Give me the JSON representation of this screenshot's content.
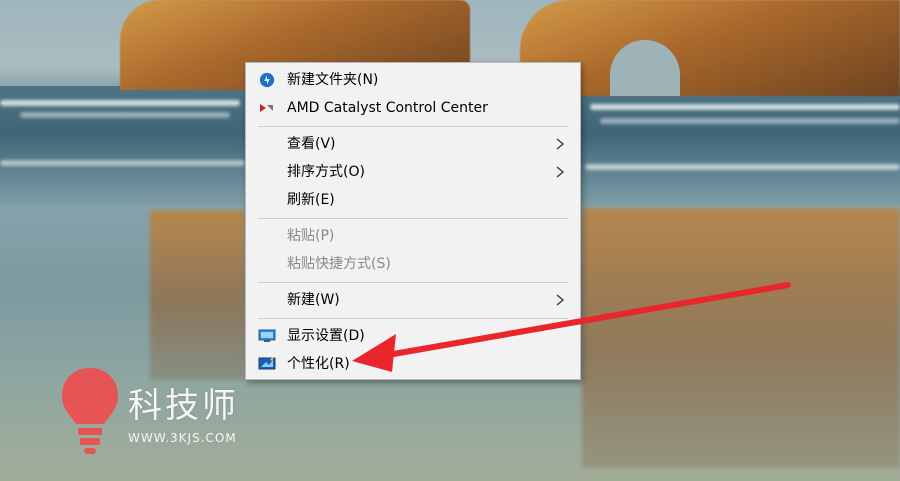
{
  "menu": {
    "items": [
      {
        "label": "新建文件夹(N)",
        "icon": "new-folder-icon",
        "submenu": false,
        "enabled": true
      },
      {
        "label": "AMD Catalyst Control Center",
        "icon": "amd-catalyst-icon",
        "submenu": false,
        "enabled": true
      },
      {
        "label": "查看(V)",
        "icon": "",
        "submenu": true,
        "enabled": true
      },
      {
        "label": "排序方式(O)",
        "icon": "",
        "submenu": true,
        "enabled": true
      },
      {
        "label": "刷新(E)",
        "icon": "",
        "submenu": false,
        "enabled": true
      },
      {
        "label": "粘贴(P)",
        "icon": "",
        "submenu": false,
        "enabled": false
      },
      {
        "label": "粘贴快捷方式(S)",
        "icon": "",
        "submenu": false,
        "enabled": false
      },
      {
        "label": "新建(W)",
        "icon": "",
        "submenu": true,
        "enabled": true
      },
      {
        "label": "显示设置(D)",
        "icon": "display-settings-icon",
        "submenu": false,
        "enabled": true
      },
      {
        "label": "个性化(R)",
        "icon": "personalize-icon",
        "submenu": false,
        "enabled": true
      }
    ]
  },
  "annotation": {
    "arrow_color": "#e8262c"
  },
  "watermark": {
    "title": "科技师",
    "url": "WWW.3KJS.COM",
    "logo_color": "#ee4b4b"
  }
}
